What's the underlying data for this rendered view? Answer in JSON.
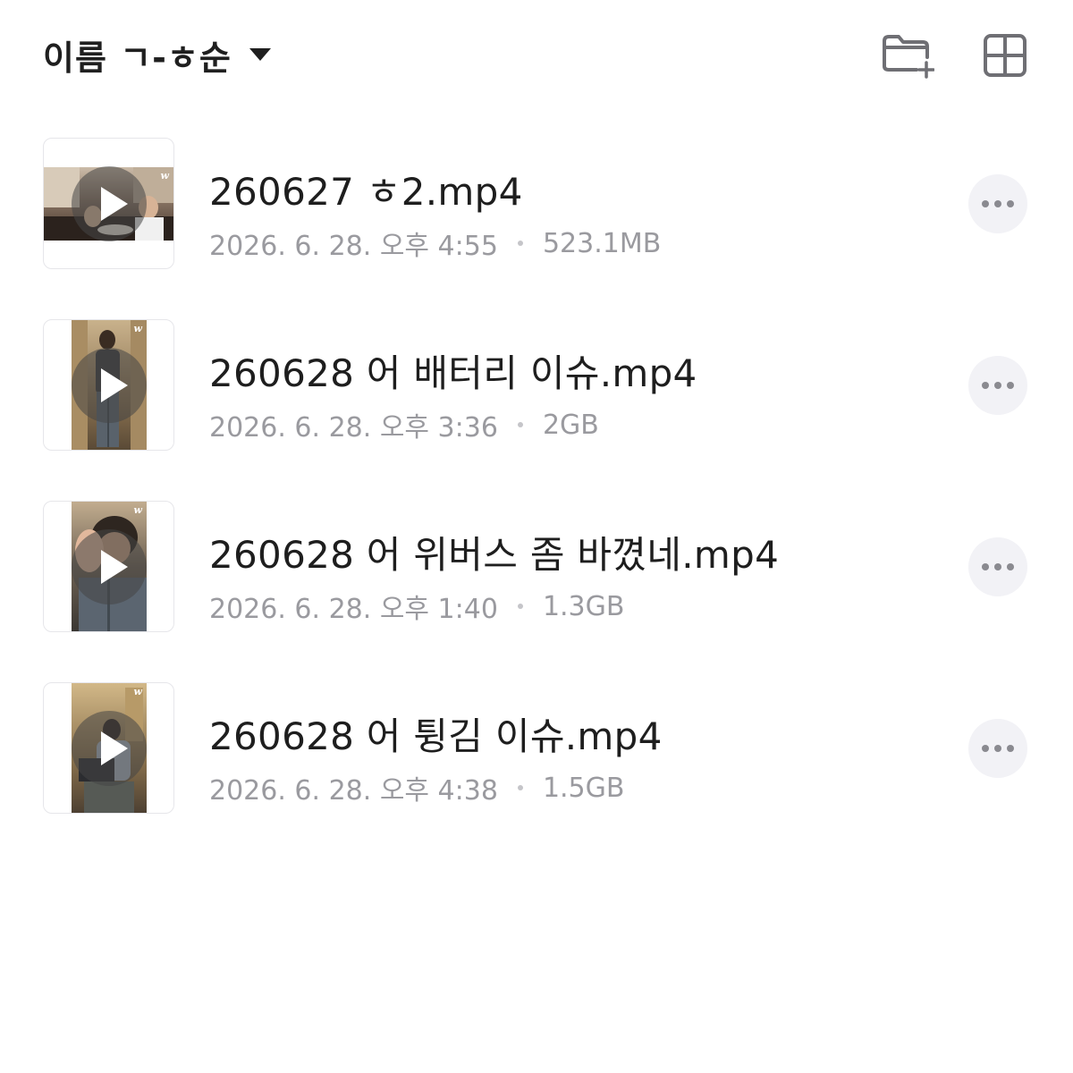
{
  "header": {
    "sort_label": "이름 ㄱ-ㅎ순",
    "sort_icon": "caret-down-icon",
    "actions": [
      {
        "name": "new-folder",
        "icon": "folder-plus-icon"
      },
      {
        "name": "grid-view",
        "icon": "grid-icon"
      }
    ]
  },
  "files": [
    {
      "name": "260627 ㅎ2.mp4",
      "date": "2026. 6. 28. 오후 4:55",
      "size": "523.1MB",
      "thumbnail": "landscape-video"
    },
    {
      "name": "260628 어 배터리 이슈.mp4",
      "date": "2026. 6. 28. 오후 3:36",
      "size": "2GB",
      "thumbnail": "portrait-video"
    },
    {
      "name": "260628 어 위버스 좀 바꼈네.mp4",
      "date": "2026. 6. 28. 오후 1:40",
      "size": "1.3GB",
      "thumbnail": "portrait-video"
    },
    {
      "name": "260628 어 튕김 이슈.mp4",
      "date": "2026. 6. 28. 오후 4:38",
      "size": "1.5GB",
      "thumbnail": "portrait-video"
    }
  ],
  "colors": {
    "text_primary": "#1e1e1e",
    "text_secondary": "#9a9a9f",
    "more_bg": "#f2f2f6",
    "icon_gray": "#6f6f74"
  }
}
